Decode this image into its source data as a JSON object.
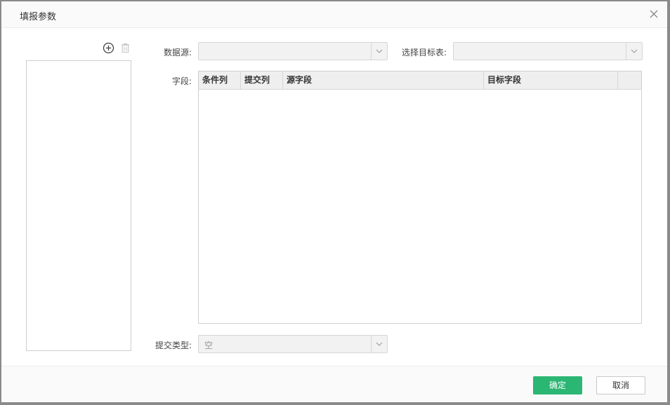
{
  "dialog": {
    "title": "填报参数",
    "close_icon": "close-icon"
  },
  "left_panel": {
    "add_icon": "add-circle-icon",
    "delete_icon": "trash-icon"
  },
  "form": {
    "datasource_label": "数据源:",
    "datasource_value": "",
    "target_table_label": "选择目标表:",
    "target_table_value": "",
    "fields_label": "字段:",
    "submit_type_label": "提交类型:",
    "submit_type_value": "空"
  },
  "fields_table": {
    "columns": [
      "条件列",
      "提交列",
      "源字段",
      "目标字段",
      ""
    ],
    "rows": []
  },
  "footer": {
    "ok_label": "确定",
    "cancel_label": "取消"
  },
  "colors": {
    "primary": "#2bb673",
    "header_bg": "#fafafa",
    "input_bg": "#f2f2f2"
  }
}
